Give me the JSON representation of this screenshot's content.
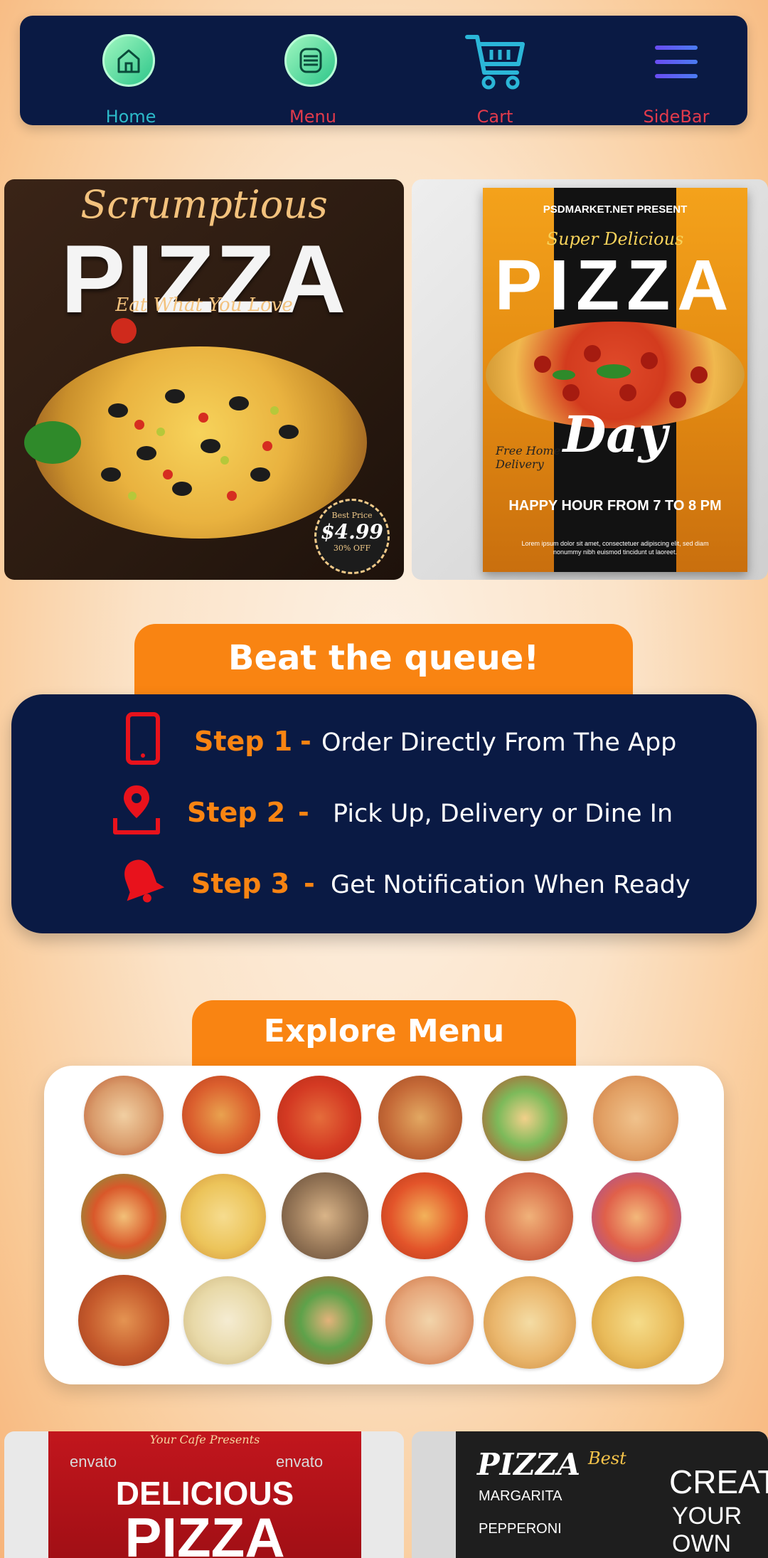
{
  "nav": {
    "items": [
      {
        "label": "Home",
        "color": "#2cb9c9",
        "icon": "home-icon"
      },
      {
        "label": "Menu",
        "color": "#e23a4b",
        "icon": "menu-icon"
      },
      {
        "label": "Cart",
        "color": "#e23a4b",
        "icon": "cart-icon"
      },
      {
        "label": "SideBar",
        "color": "#e23a4b",
        "icon": "hamburger-icon"
      }
    ]
  },
  "banners": {
    "left": {
      "script_title": "Scrumptious",
      "big_title": "PIZZA",
      "tagline": "Eat What You Love",
      "price_label": "Best Price",
      "price": "$4.99",
      "discount": "30% OFF"
    },
    "right": {
      "presenter": "PSDMARKET.NET PRESENT",
      "subtitle": "Super Delicious",
      "big_title": "PIZZA",
      "day": "Day",
      "free": "Free Home Delivery",
      "happy_hour": "HAPPY HOUR FROM 7 TO 8 PM",
      "lorem": "Lorem ipsum dolor sit amet, consectetuer adipiscing elit, sed diam nonummy nibh euismod tincidunt ut laoreet."
    }
  },
  "queue": {
    "title": "Beat the queue!",
    "steps": [
      {
        "label": "Step 1",
        "dash": "-",
        "text": "Order Directly From The App",
        "icon": "phone-icon"
      },
      {
        "label": "Step 2",
        "dash": "-",
        "text": "Pick Up, Delivery or Dine In",
        "icon": "location-pin-icon"
      },
      {
        "label": "Step 3",
        "dash": "-",
        "text": "Get Notification When Ready",
        "icon": "bell-icon"
      }
    ]
  },
  "explore": {
    "title": "Explore Menu"
  },
  "bottom_banners": {
    "left": {
      "presents": "Your Cafe Presents",
      "line1": "DELICIOUS",
      "line2": "PIZZA",
      "watermark": "envato"
    },
    "right": {
      "title": "PIZZA",
      "item1": "MARGARITA",
      "item2": "PEPPERONI",
      "best": "Best",
      "creat": "CREAT",
      "your_own": "YOUR OWN"
    }
  },
  "colors": {
    "navy": "#0a1a44",
    "orange": "#f98412",
    "accent_red": "#e23a4b",
    "icon_red": "#e8121c",
    "teal": "#2cb9c9"
  }
}
